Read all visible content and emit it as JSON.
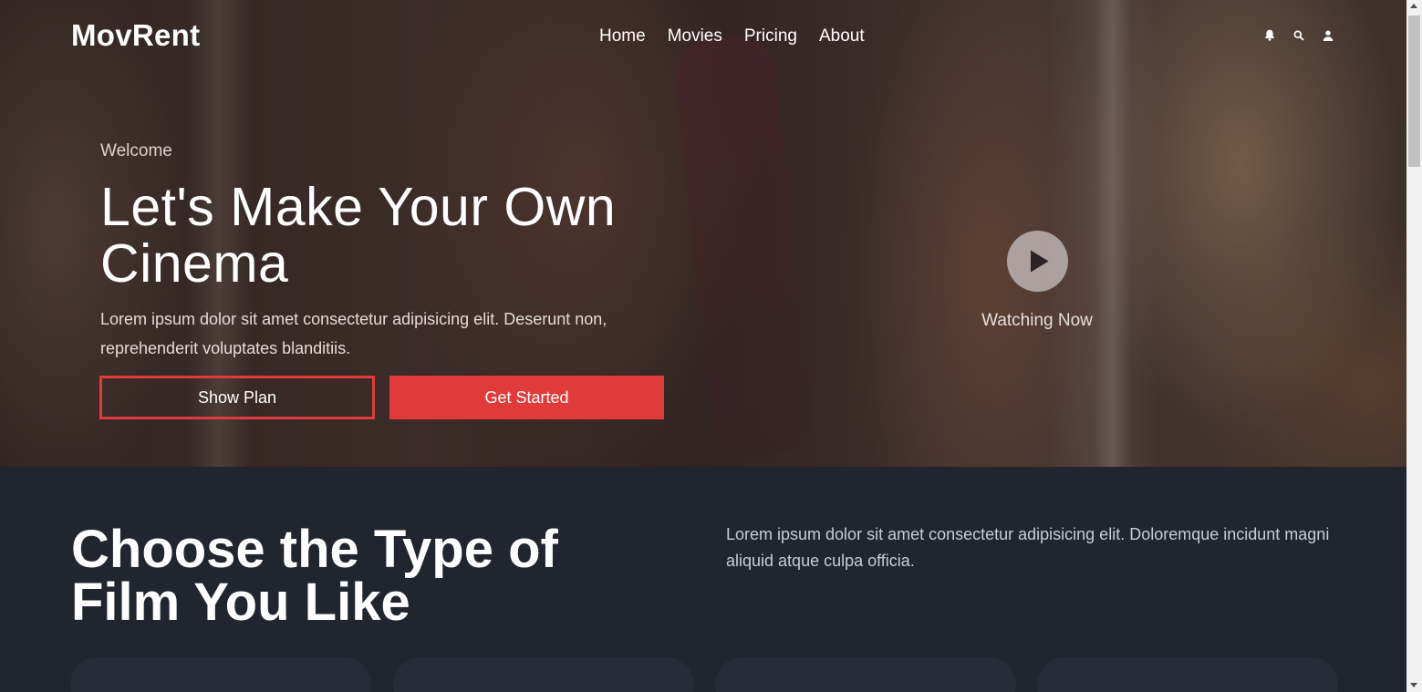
{
  "brand": {
    "logo": "MovRent"
  },
  "nav": {
    "items": [
      {
        "label": "Home"
      },
      {
        "label": "Movies"
      },
      {
        "label": "Pricing"
      },
      {
        "label": "About"
      }
    ],
    "icons": [
      "bell-icon",
      "search-icon",
      "user-icon"
    ]
  },
  "hero": {
    "welcome": "Welcome",
    "title": "Let's Make Your Own Cinema",
    "text": "Lorem ipsum dolor sit amet consectetur adipisicing elit. Deserunt non, reprehenderit voluptates blanditiis.",
    "show_plan_label": "Show Plan",
    "get_started_label": "Get Started",
    "watching_label": "Watching Now"
  },
  "section2": {
    "title": "Choose the Type of Film You Like",
    "text": "Lorem ipsum dolor sit amet consectetur adipisicing elit. Doloremque incidunt magni aliquid atque culpa officia."
  },
  "colors": {
    "accent": "#e03b3a",
    "dark_bg": "#21252e",
    "card_bg": "#282c36"
  }
}
